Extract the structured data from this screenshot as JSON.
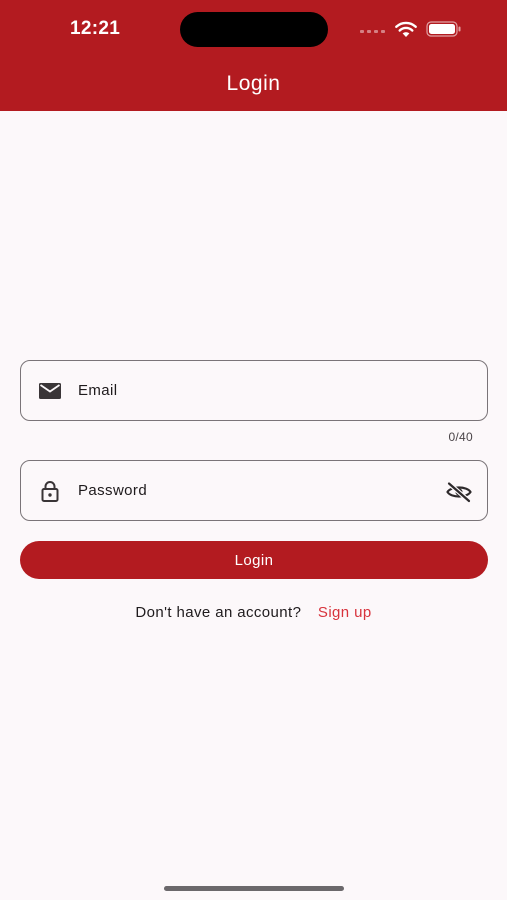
{
  "status_bar": {
    "time": "12:21"
  },
  "app_bar": {
    "title": "Login"
  },
  "form": {
    "email": {
      "label": "Email",
      "counter": "0/40"
    },
    "password": {
      "label": "Password"
    },
    "login_button": "Login"
  },
  "signup": {
    "prompt": "Don't have an account?",
    "link": "Sign up"
  },
  "colors": {
    "primary": "#B31B20",
    "link": "#D8333C",
    "background": "#FCF8FA",
    "outline": "#7A7478"
  },
  "icons": {
    "email": "mail-icon",
    "password": "lock-icon",
    "visibility": "visibility-off-icon"
  }
}
